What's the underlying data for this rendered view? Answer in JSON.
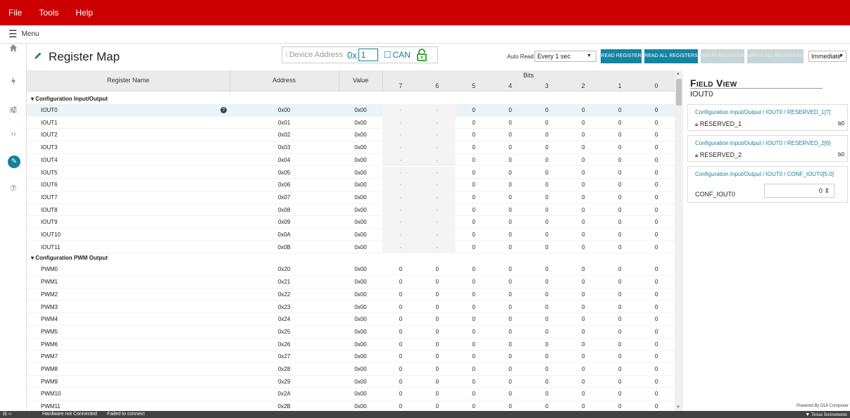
{
  "menu": {
    "items": [
      "File",
      "Tools",
      "Help"
    ]
  },
  "subbar": {
    "label": "Menu"
  },
  "nav": {
    "icons": [
      "home-icon",
      "microchip-icon",
      "sliders-icon",
      "code-icon",
      "pencil-icon",
      "help-icon"
    ]
  },
  "header": {
    "title": "Register Map",
    "device_address_label": "Device Address",
    "hex_prefix": "0x",
    "device_address_value": "1",
    "can_label": "CAN",
    "auto_read_label": "Auto Read",
    "auto_read_value": "Every 1 sec",
    "read_register": "READ REGISTER",
    "read_all_registers": "READ ALL REGISTERS",
    "write_register": "WRITE REGISTER",
    "write_all_registers": "WRITE ALL REGISTERS",
    "mode_value": "Immediate"
  },
  "grid": {
    "col_name": "Register Name",
    "col_address": "Address",
    "col_value": "Value",
    "col_bits": "Bits",
    "bit_labels": [
      "7",
      "6",
      "5",
      "4",
      "3",
      "2",
      "1",
      "0"
    ],
    "groups": [
      {
        "name": "Configuration Input/Output",
        "rows": [
          {
            "name": "IOUT0",
            "address": "0x00",
            "value": "0x00",
            "bits": [
              "-",
              "-",
              "0",
              "0",
              "0",
              "0",
              "0",
              "0"
            ]
          },
          {
            "name": "IOUT1",
            "address": "0x01",
            "value": "0x00",
            "bits": [
              "-",
              "-",
              "0",
              "0",
              "0",
              "0",
              "0",
              "0"
            ]
          },
          {
            "name": "IOUT2",
            "address": "0x02",
            "value": "0x00",
            "bits": [
              "-",
              "-",
              "0",
              "0",
              "0",
              "0",
              "0",
              "0"
            ]
          },
          {
            "name": "IOUT3",
            "address": "0x03",
            "value": "0x00",
            "bits": [
              "-",
              "-",
              "0",
              "0",
              "0",
              "0",
              "0",
              "0"
            ]
          },
          {
            "name": "IOUT4",
            "address": "0x04",
            "value": "0x00",
            "bits": [
              "-",
              "-",
              "0",
              "0",
              "0",
              "0",
              "0",
              "0"
            ]
          },
          {
            "name": "IOUT5",
            "address": "0x05",
            "value": "0x00",
            "bits": [
              "-",
              "-",
              "0",
              "0",
              "0",
              "0",
              "0",
              "0"
            ]
          },
          {
            "name": "IOUT6",
            "address": "0x06",
            "value": "0x00",
            "bits": [
              "-",
              "-",
              "0",
              "0",
              "0",
              "0",
              "0",
              "0"
            ]
          },
          {
            "name": "IOUT7",
            "address": "0x07",
            "value": "0x00",
            "bits": [
              "-",
              "-",
              "0",
              "0",
              "0",
              "0",
              "0",
              "0"
            ]
          },
          {
            "name": "IOUT8",
            "address": "0x08",
            "value": "0x00",
            "bits": [
              "-",
              "-",
              "0",
              "0",
              "0",
              "0",
              "0",
              "0"
            ]
          },
          {
            "name": "IOUT9",
            "address": "0x09",
            "value": "0x00",
            "bits": [
              "-",
              "-",
              "0",
              "0",
              "0",
              "0",
              "0",
              "0"
            ]
          },
          {
            "name": "IOUT10",
            "address": "0x0A",
            "value": "0x00",
            "bits": [
              "-",
              "-",
              "0",
              "0",
              "0",
              "0",
              "0",
              "0"
            ]
          },
          {
            "name": "IOUT11",
            "address": "0x0B",
            "value": "0x00",
            "bits": [
              "-",
              "-",
              "0",
              "0",
              "0",
              "0",
              "0",
              "0"
            ]
          }
        ]
      },
      {
        "name": "Configuration PWM Output",
        "rows": [
          {
            "name": "PWM0",
            "address": "0x20",
            "value": "0x00",
            "bits": [
              "0",
              "0",
              "0",
              "0",
              "0",
              "0",
              "0",
              "0"
            ]
          },
          {
            "name": "PWM1",
            "address": "0x21",
            "value": "0x00",
            "bits": [
              "0",
              "0",
              "0",
              "0",
              "0",
              "0",
              "0",
              "0"
            ]
          },
          {
            "name": "PWM2",
            "address": "0x22",
            "value": "0x00",
            "bits": [
              "0",
              "0",
              "0",
              "0",
              "0",
              "0",
              "0",
              "0"
            ]
          },
          {
            "name": "PWM3",
            "address": "0x23",
            "value": "0x00",
            "bits": [
              "0",
              "0",
              "0",
              "0",
              "0",
              "0",
              "0",
              "0"
            ]
          },
          {
            "name": "PWM4",
            "address": "0x24",
            "value": "0x00",
            "bits": [
              "0",
              "0",
              "0",
              "0",
              "0",
              "0",
              "0",
              "0"
            ]
          },
          {
            "name": "PWM5",
            "address": "0x25",
            "value": "0x00",
            "bits": [
              "0",
              "0",
              "0",
              "0",
              "0",
              "0",
              "0",
              "0"
            ]
          },
          {
            "name": "PWM6",
            "address": "0x26",
            "value": "0x00",
            "bits": [
              "0",
              "0",
              "0",
              "0",
              "0",
              "0",
              "0",
              "0"
            ]
          },
          {
            "name": "PWM7",
            "address": "0x27",
            "value": "0x00",
            "bits": [
              "0",
              "0",
              "0",
              "0",
              "0",
              "0",
              "0",
              "0"
            ]
          },
          {
            "name": "PWM8",
            "address": "0x28",
            "value": "0x00",
            "bits": [
              "0",
              "0",
              "0",
              "0",
              "0",
              "0",
              "0",
              "0"
            ]
          },
          {
            "name": "PWM9",
            "address": "0x29",
            "value": "0x00",
            "bits": [
              "0",
              "0",
              "0",
              "0",
              "0",
              "0",
              "0",
              "0"
            ]
          },
          {
            "name": "PWM10",
            "address": "0x2A",
            "value": "0x00",
            "bits": [
              "0",
              "0",
              "0",
              "0",
              "0",
              "0",
              "0",
              "0"
            ]
          },
          {
            "name": "PWM11",
            "address": "0x2B",
            "value": "0x00",
            "bits": [
              "0",
              "0",
              "0",
              "0",
              "0",
              "0",
              "0",
              "0"
            ]
          }
        ]
      }
    ]
  },
  "field_view": {
    "title": "Field View",
    "register": "IOUT0",
    "cards": [
      {
        "path": "Configuration Input/Output / IOUT0 / RESERVED_1[7]",
        "field": "RESERVED_1",
        "value": "b0"
      },
      {
        "path": "Configuration Input/Output / IOUT0 / RESERVED_2[6]",
        "field": "RESERVED_2",
        "value": "b0"
      },
      {
        "path": "Configuration Input/Output / IOUT0 / CONF_IOUT0[5:0]",
        "field": "CONF_IOUT0",
        "value": "0"
      }
    ],
    "powered_by": "Powered By GUI Composer"
  },
  "status": {
    "hardware": "Hardware not Connected",
    "connect": "Failed to connect",
    "brand": "Texas Instruments"
  },
  "colors": {
    "brand_red": "#cc0000",
    "accent_teal": "#1484a2"
  }
}
